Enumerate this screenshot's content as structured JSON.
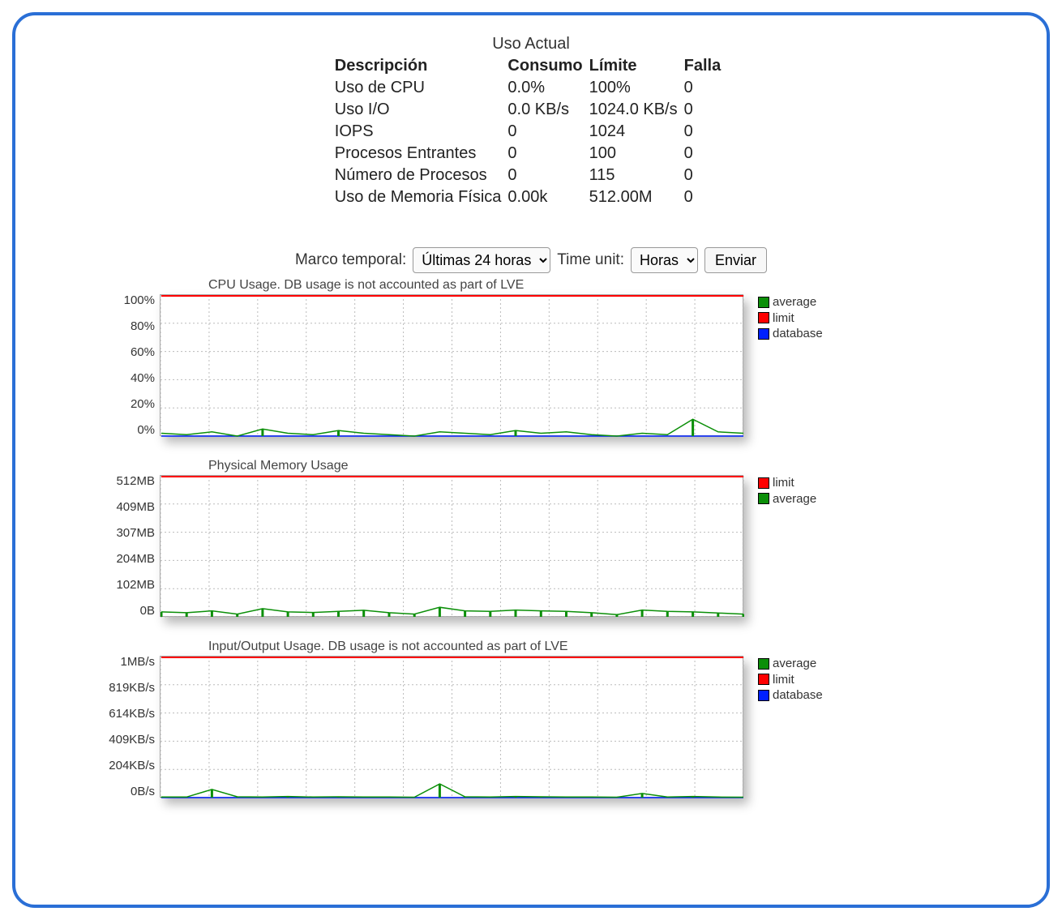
{
  "table": {
    "caption": "Uso Actual",
    "headers": [
      "Descripción",
      "Consumo",
      "Límite",
      "Falla"
    ],
    "rows": [
      {
        "desc": "Uso de CPU",
        "consumo": "0.0%",
        "limite": "100%",
        "falla": "0"
      },
      {
        "desc": "Uso I/O",
        "consumo": "0.0 KB/s",
        "limite": "1024.0 KB/s",
        "falla": "0"
      },
      {
        "desc": "IOPS",
        "consumo": "0",
        "limite": "1024",
        "falla": "0"
      },
      {
        "desc": "Procesos Entrantes",
        "consumo": "0",
        "limite": "100",
        "falla": "0"
      },
      {
        "desc": "Número de Procesos",
        "consumo": "0",
        "limite": "115",
        "falla": "0"
      },
      {
        "desc": "Uso de Memoria Física",
        "consumo": "0.00k",
        "limite": "512.00M",
        "falla": "0"
      }
    ]
  },
  "controls": {
    "timeframe_label": "Marco temporal:",
    "timeframe_value": "Últimas 24 horas",
    "timeunit_label": "Time unit:",
    "timeunit_value": "Horas",
    "submit_label": "Enviar"
  },
  "legend_labels": {
    "average": "average",
    "limit": "limit",
    "database": "database"
  },
  "colors": {
    "average": "#0b8f08",
    "limit": "#ff0000",
    "database": "#0020ff"
  },
  "chart_data": [
    {
      "type": "line",
      "title": "CPU Usage. DB usage is not accounted as part of LVE",
      "ylabel": "",
      "yticks": [
        "100%",
        "80%",
        "60%",
        "40%",
        "20%",
        "0%"
      ],
      "ylim": [
        0,
        100
      ],
      "legend": [
        "average",
        "limit",
        "database"
      ],
      "x": [
        0,
        1,
        2,
        3,
        4,
        5,
        6,
        7,
        8,
        9,
        10,
        11,
        12,
        13,
        14,
        15,
        16,
        17,
        18,
        19,
        20,
        21,
        22,
        23
      ],
      "series": [
        {
          "name": "limit",
          "values": [
            100,
            100,
            100,
            100,
            100,
            100,
            100,
            100,
            100,
            100,
            100,
            100,
            100,
            100,
            100,
            100,
            100,
            100,
            100,
            100,
            100,
            100,
            100,
            100
          ]
        },
        {
          "name": "database",
          "values": [
            0,
            0,
            0,
            0,
            0,
            0,
            0,
            0,
            0,
            0,
            0,
            0,
            0,
            0,
            0,
            0,
            0,
            0,
            0,
            0,
            0,
            0,
            0,
            0
          ]
        },
        {
          "name": "average",
          "values": [
            2,
            1,
            3,
            0,
            5,
            2,
            1,
            4,
            2,
            1,
            0,
            3,
            2,
            1,
            4,
            2,
            3,
            1,
            0,
            2,
            1,
            12,
            3,
            2
          ]
        }
      ]
    },
    {
      "type": "line",
      "title": "Physical Memory Usage",
      "ylabel": "",
      "yticks": [
        "512MB",
        "409MB",
        "307MB",
        "204MB",
        "102MB",
        "0B"
      ],
      "ylim": [
        0,
        512
      ],
      "legend": [
        "limit",
        "average"
      ],
      "x": [
        0,
        1,
        2,
        3,
        4,
        5,
        6,
        7,
        8,
        9,
        10,
        11,
        12,
        13,
        14,
        15,
        16,
        17,
        18,
        19,
        20,
        21,
        22,
        23
      ],
      "series": [
        {
          "name": "limit",
          "values": [
            512,
            512,
            512,
            512,
            512,
            512,
            512,
            512,
            512,
            512,
            512,
            512,
            512,
            512,
            512,
            512,
            512,
            512,
            512,
            512,
            512,
            512,
            512,
            512
          ]
        },
        {
          "name": "average",
          "values": [
            18,
            15,
            22,
            10,
            30,
            18,
            16,
            20,
            24,
            15,
            10,
            35,
            22,
            20,
            25,
            22,
            20,
            15,
            8,
            25,
            20,
            18,
            14,
            10
          ]
        }
      ]
    },
    {
      "type": "line",
      "title": "Input/Output Usage. DB usage is not accounted as part of LVE",
      "ylabel": "",
      "yticks": [
        "1MB/s",
        "819KB/s",
        "614KB/s",
        "409KB/s",
        "204KB/s",
        "0B/s"
      ],
      "ylim": [
        0,
        1024
      ],
      "legend": [
        "average",
        "limit",
        "database"
      ],
      "x": [
        0,
        1,
        2,
        3,
        4,
        5,
        6,
        7,
        8,
        9,
        10,
        11,
        12,
        13,
        14,
        15,
        16,
        17,
        18,
        19,
        20,
        21,
        22,
        23
      ],
      "series": [
        {
          "name": "limit",
          "values": [
            1024,
            1024,
            1024,
            1024,
            1024,
            1024,
            1024,
            1024,
            1024,
            1024,
            1024,
            1024,
            1024,
            1024,
            1024,
            1024,
            1024,
            1024,
            1024,
            1024,
            1024,
            1024,
            1024,
            1024
          ]
        },
        {
          "name": "database",
          "values": [
            0,
            0,
            0,
            0,
            0,
            0,
            0,
            0,
            0,
            0,
            0,
            0,
            0,
            0,
            0,
            0,
            0,
            0,
            0,
            0,
            0,
            0,
            0,
            0
          ]
        },
        {
          "name": "average",
          "values": [
            5,
            4,
            60,
            6,
            5,
            8,
            4,
            6,
            5,
            4,
            3,
            100,
            6,
            5,
            8,
            6,
            5,
            4,
            3,
            30,
            5,
            8,
            4,
            3
          ]
        }
      ]
    }
  ]
}
